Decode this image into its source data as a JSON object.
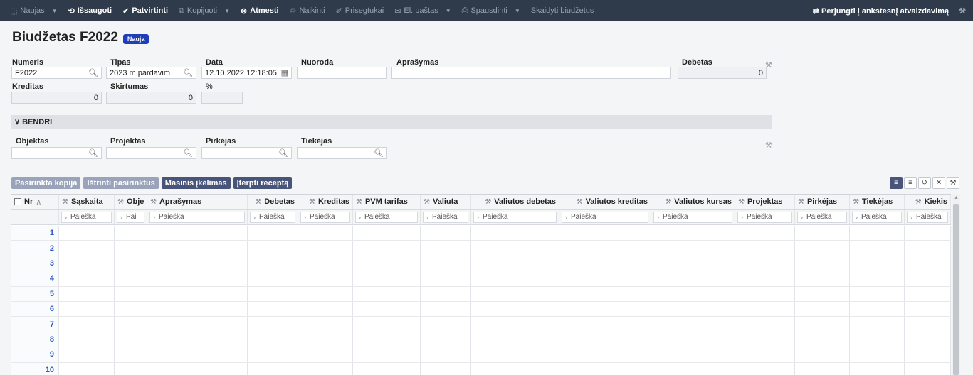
{
  "toolbar": {
    "items": [
      {
        "icon": "document-add-icon",
        "label": "Naujas",
        "caret": true,
        "dim": true
      },
      {
        "icon": "save-icon",
        "label": "Išsaugoti",
        "caret": false,
        "dim": false
      },
      {
        "icon": "check-icon",
        "label": "Patvirtinti",
        "caret": false,
        "dim": false
      },
      {
        "icon": "copy-icon",
        "label": "Kopijuoti",
        "caret": true,
        "dim": true
      },
      {
        "icon": "cancel-icon",
        "label": "Atmesti",
        "caret": false,
        "dim": false
      },
      {
        "icon": "trash-icon",
        "label": "Naikinti",
        "caret": false,
        "dim": true
      },
      {
        "icon": "paperclip-icon",
        "label": "Prisegtukai",
        "caret": false,
        "dim": true
      },
      {
        "icon": "mail-icon",
        "label": "El. paštas",
        "caret": true,
        "dim": true
      },
      {
        "icon": "printer-icon",
        "label": "Spausdinti",
        "caret": true,
        "dim": true
      },
      {
        "icon": "",
        "label": "Skaidyti biudžetus",
        "caret": false,
        "dim": true
      }
    ],
    "switch_view_label": "Perjungti į ankstesnį atvaizdavimą"
  },
  "header": {
    "title": "Biudžetas F2022",
    "status_badge": "Nauja"
  },
  "form": {
    "numeris_label": "Numeris",
    "numeris_value": "F2022",
    "tipas_label": "Tipas",
    "tipas_value": "2023 m pardavim",
    "data_label": "Data",
    "data_value": "12.10.2022 12:18:05",
    "nuoroda_label": "Nuoroda",
    "nuoroda_value": "",
    "aprasymas_label": "Aprašymas",
    "aprasymas_value": "",
    "debetas_label": "Debetas",
    "debetas_value": "0",
    "kreditas_label": "Kreditas",
    "kreditas_value": "0",
    "skirtumas_label": "Skirtumas",
    "skirtumas_value": "0",
    "percent_label": "%",
    "percent_value": ""
  },
  "section_bendri": {
    "title": "BENDRI",
    "objektas_label": "Objektas",
    "objektas_value": "",
    "projektas_label": "Projektas",
    "projektas_value": "",
    "pirkejas_label": "Pirkėjas",
    "pirkejas_value": "",
    "tiekejas_label": "Tiekėjas",
    "tiekejas_value": ""
  },
  "grid_buttons": {
    "copy_selected": "Pasirinkta kopija",
    "delete_selected": "Ištrinti pasirinktus",
    "mass_import": "Masinis įkėlimas",
    "insert_recipe": "Įterpti receptą"
  },
  "grid": {
    "columns": [
      {
        "key": "nr",
        "label": "Nr"
      },
      {
        "key": "saskaita",
        "label": "Sąskaita"
      },
      {
        "key": "objektas",
        "label": "Obje"
      },
      {
        "key": "aprasymas",
        "label": "Aprašymas"
      },
      {
        "key": "debetas",
        "label": "Debetas"
      },
      {
        "key": "kreditas",
        "label": "Kreditas"
      },
      {
        "key": "pvm",
        "label": "PVM tarifas"
      },
      {
        "key": "valiuta",
        "label": "Valiuta"
      },
      {
        "key": "valiutos_debetas",
        "label": "Valiutos debetas"
      },
      {
        "key": "valiutos_kreditas",
        "label": "Valiutos kreditas"
      },
      {
        "key": "valiutos_kursas",
        "label": "Valiutos kursas"
      },
      {
        "key": "projektas",
        "label": "Projektas"
      },
      {
        "key": "pirkejas",
        "label": "Pirkėjas"
      },
      {
        "key": "tiekejas",
        "label": "Tiekėjas"
      },
      {
        "key": "kiekis",
        "label": "Kiekis"
      }
    ],
    "filter_placeholders": [
      "Paieška",
      "Pai",
      "Paieška",
      "Paieška",
      "Paieška",
      "Paieška",
      "Paieška",
      "Paieška",
      "Paieška",
      "Paieška",
      "Paieška",
      "Paieška",
      "Paieška",
      "Paieška"
    ],
    "row_numbers": [
      "1",
      "2",
      "3",
      "4",
      "5",
      "6",
      "7",
      "8",
      "9",
      "10"
    ]
  }
}
